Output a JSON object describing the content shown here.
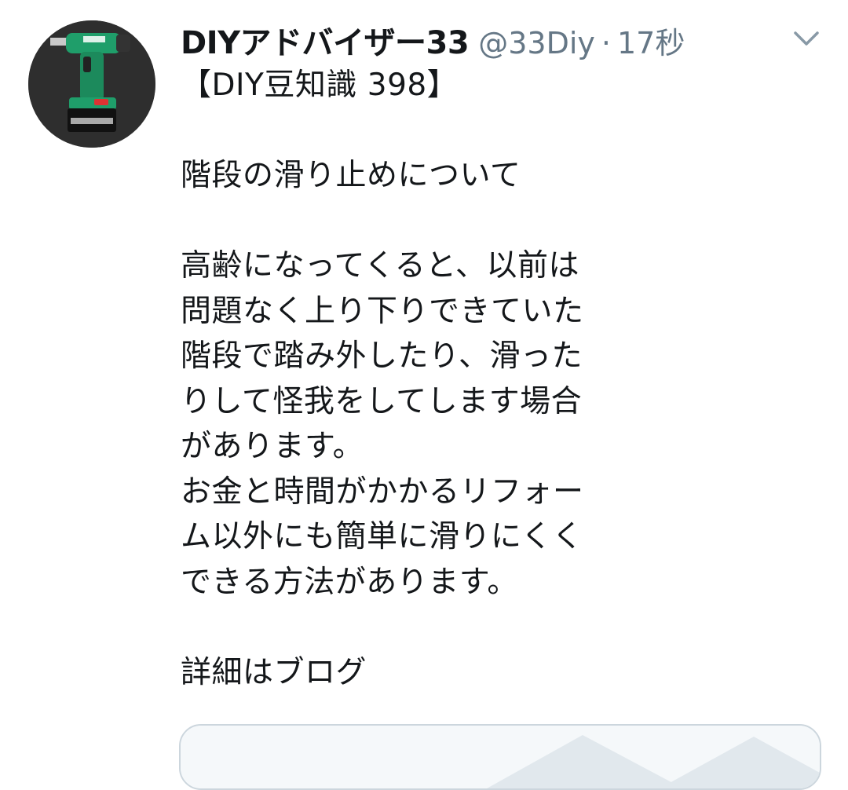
{
  "tweet": {
    "display_name": "DIYアドバイザー33",
    "handle": "@33Diy",
    "separator": "·",
    "time": "17秒",
    "text": "【DIY豆知識 398】\n\n階段の滑り止めについて\n\n高齢になってくると、以前は\n問題なく上り下りできていた\n階段で踏み外したり、滑った\nりして怪我をしてします場合\nがあります。\nお金と時間がかかるリフォー\nム以外にも簡単に滑りにくく\nできる方法があります。\n\n詳細はブログ"
  },
  "icons": {
    "avatar": "drill-avatar",
    "menu": "chevron-down-icon"
  },
  "colors": {
    "primary_text": "#14171a",
    "secondary_text": "#657786",
    "card_border": "#ccd6dd",
    "card_bg": "#f5f8fa"
  }
}
